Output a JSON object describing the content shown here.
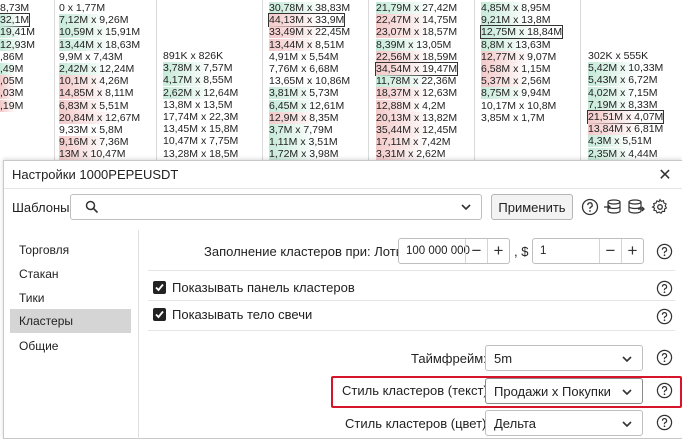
{
  "background_clusters": {
    "columns": [
      {
        "cells": [
          {
            "text": "8,73M"
          },
          {
            "text": "32,1M",
            "boxed": true
          },
          {
            "text": "19,41M"
          },
          {
            "text": "12,93M"
          },
          {
            "text": ",86M"
          },
          {
            "text": ",49M"
          },
          {
            "text": ",05M"
          },
          {
            "text": ",03M"
          },
          {
            "text": ",19M"
          }
        ]
      },
      {
        "cells": [
          {
            "text": "0 x 1,77M"
          },
          {
            "text": "7,12M x 9,26M"
          },
          {
            "text": "10,59M x 15,91M"
          },
          {
            "text": "13,44M x 18,63M"
          },
          {
            "text": "9,9M x 7,43M"
          },
          {
            "text": "2,42M x 12,24M"
          },
          {
            "text": "10,1M x 4,26M"
          },
          {
            "text": "14,85M x 8,11M"
          },
          {
            "text": "6,83M x 5,51M"
          },
          {
            "text": "20,84M x 12,67M"
          },
          {
            "text": "9,33M x 5,8M"
          },
          {
            "text": "9,16M x 7,36M"
          },
          {
            "text": "13M x 10,47M"
          }
        ]
      },
      {
        "cells": [
          {
            "text": "891K x 826K"
          },
          {
            "text": "3,78M x 7,57M"
          },
          {
            "text": "4,17M x 8,55M"
          },
          {
            "text": "2,62M x 12,64M"
          },
          {
            "text": "13,8M x 13,5M"
          },
          {
            "text": "17,74M x 22,3M"
          },
          {
            "text": "13,45M x 15,8M"
          },
          {
            "text": "10,47M x 7,75M"
          },
          {
            "text": "13,28M x 18,5M"
          },
          {
            "text": "10,47M x 7,5M"
          }
        ]
      },
      {
        "cells": [
          {
            "text": "30,78M x 38,83M"
          },
          {
            "text": "44,13M x 33,9M",
            "boxed": true
          },
          {
            "text": "33,49M x 22,45M"
          },
          {
            "text": "13,44M x 8,51M"
          },
          {
            "text": "4,91M x 5,54M"
          },
          {
            "text": "7,76M x 6,68M"
          },
          {
            "text": "13,65M x 10,86M"
          },
          {
            "text": "3,81M x 5,73M"
          },
          {
            "text": "6,45M x 12,61M"
          },
          {
            "text": "12,9M x 8,35M"
          },
          {
            "text": "3,7M x 7,79M"
          },
          {
            "text": "1,11M x 3,51M"
          },
          {
            "text": "1,72M x 3,98M"
          }
        ]
      },
      {
        "cells": [
          {
            "text": "21,79M x 27,42M"
          },
          {
            "text": "22,47M x 14,75M"
          },
          {
            "text": "23,07M x 18,57M"
          },
          {
            "text": "8,39M x 13,05M"
          },
          {
            "text": "22,56M x 18,59M"
          },
          {
            "text": "34,54M x 19,47M",
            "boxed": true
          },
          {
            "text": "11,78M x 22,36M"
          },
          {
            "text": "18,37M x 12,63M"
          },
          {
            "text": "12,88M x 4,2M"
          },
          {
            "text": "20,13M x 13,82M"
          },
          {
            "text": "35,44M x 12,45M"
          },
          {
            "text": "17,11M x 7,42M"
          },
          {
            "text": "3,31M x 2,62M"
          }
        ]
      },
      {
        "cells": [
          {
            "text": "4,85M x 8,95M"
          },
          {
            "text": "9,21M x 13,8M"
          },
          {
            "text": "12,75M x 18,84M",
            "boxed": true
          },
          {
            "text": "8,8M x 13,63M"
          },
          {
            "text": "12,77M x 9,07M"
          },
          {
            "text": "6,58M x 1,15M"
          },
          {
            "text": "5,37M x 2,56M"
          },
          {
            "text": "8,75M x 9,94M"
          },
          {
            "text": "10,17M x 10,8M"
          },
          {
            "text": "3,85M x 1,7M"
          }
        ]
      },
      {
        "cells": [
          {
            "text": "302K x 555K"
          },
          {
            "text": "5,42M x 10,33M"
          },
          {
            "text": "5,43M x 6,72M"
          },
          {
            "text": "4,02M x 7,15M"
          },
          {
            "text": "7,19M x 8,33M"
          },
          {
            "text": "21,51M x 4,07M",
            "boxed": true
          },
          {
            "text": "13,84M x 6,81M"
          },
          {
            "text": "4,3M x 5,51M"
          },
          {
            "text": "2,35M x 4,44M"
          }
        ]
      }
    ]
  },
  "dialog": {
    "title": "Настройки 1000PEPEUSDT",
    "templates_label": "Шаблоны:",
    "templates_value": "",
    "apply_label": "Применить",
    "sidebar": [
      {
        "label": "Торговля"
      },
      {
        "label": "Стакан"
      },
      {
        "label": "Тики"
      },
      {
        "label": "Кластеры",
        "active": true
      },
      {
        "label": "Общие"
      }
    ],
    "fill_label": "Заполнение кластеров при: Лоты",
    "fill_lots_value": "100 000 000",
    "fill_usd_label": ", $",
    "fill_usd_value": "1",
    "show_panel_label": "Показывать панель кластеров",
    "show_panel_checked": true,
    "show_body_label": "Показывать тело свечи",
    "show_body_checked": true,
    "timeframe_label": "Таймфрейм:",
    "timeframe_value": "5m",
    "style_text_label": "Стиль кластеров (текст):",
    "style_text_value": "Продажи x Покупки",
    "style_color_label": "Стиль кластеров (цвет):",
    "style_color_value": "Дельта",
    "icons": {
      "close": "close-icon",
      "search": "search-icon",
      "chevron": "chevron-down-icon",
      "help": "help-icon",
      "import": "import-icon",
      "export": "export-icon",
      "settings": "gear-icon"
    },
    "colors": {
      "highlight": "#d6152a",
      "sell": "#f3c9c9",
      "buy": "#c6ead9",
      "sell_bar": "#e48a8a",
      "buy_bar": "#5fc39a"
    }
  }
}
